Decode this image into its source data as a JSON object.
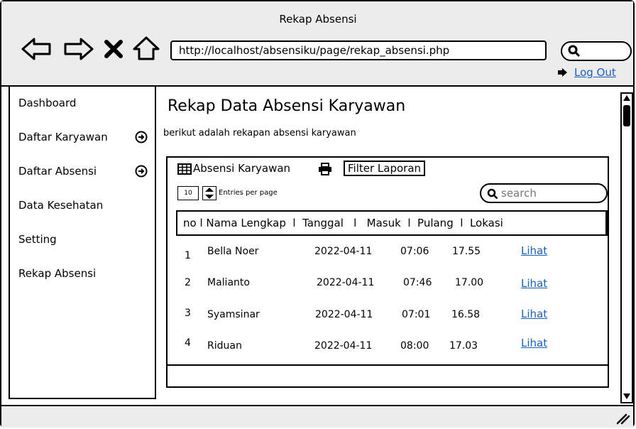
{
  "window": {
    "title": "Rekap Absensi"
  },
  "browser": {
    "url": "http://localhost/absensiku/page/rekap_absensi.php",
    "logout_label": "Log Out"
  },
  "sidebar": {
    "items": [
      {
        "label": "Dashboard",
        "has_arrow": false
      },
      {
        "label": "Daftar Karyawan",
        "has_arrow": true
      },
      {
        "label": "Daftar Absensi",
        "has_arrow": true
      },
      {
        "label": "Data Kesehatan",
        "has_arrow": false
      },
      {
        "label": "Setting",
        "has_arrow": false
      },
      {
        "label": "Rekap Absensi",
        "has_arrow": false
      }
    ]
  },
  "main": {
    "heading": "Rekap Data Absensi Karyawan",
    "subtitle": "berikut adalah rekapan absensi karyawan",
    "panel": {
      "tab_label": "Absensi Karyawan",
      "filter_label": "Filter Laporan",
      "entries_value": "10",
      "entries_label": "Entries per page",
      "search_placeholder": "search",
      "header_text": "no l Nama Lengkap  l  Tanggal   l   Masuk  l  Pulang  l  Lokasi",
      "rows": [
        {
          "no": "1",
          "nama": "Bella Noer",
          "tanggal": "2022-04-11",
          "masuk": "07:06",
          "pulang": "17.55",
          "lokasi": "Lihat"
        },
        {
          "no": "2",
          "nama": "Malianto",
          "tanggal": "2022-04-11",
          "masuk": "07:46",
          "pulang": "17.00",
          "lokasi": "Lihat"
        },
        {
          "no": "3",
          "nama": "Syamsinar",
          "tanggal": "2022-04-11",
          "masuk": "07:01",
          "pulang": "16.58",
          "lokasi": "Lihat"
        },
        {
          "no": "4",
          "nama": "Riduan",
          "tanggal": "2022-04-11",
          "masuk": "08:00",
          "pulang": "17.03",
          "lokasi": "Lihat"
        }
      ]
    }
  },
  "colors": {
    "link": "#1a5fc1",
    "chrome": "#ececec"
  }
}
